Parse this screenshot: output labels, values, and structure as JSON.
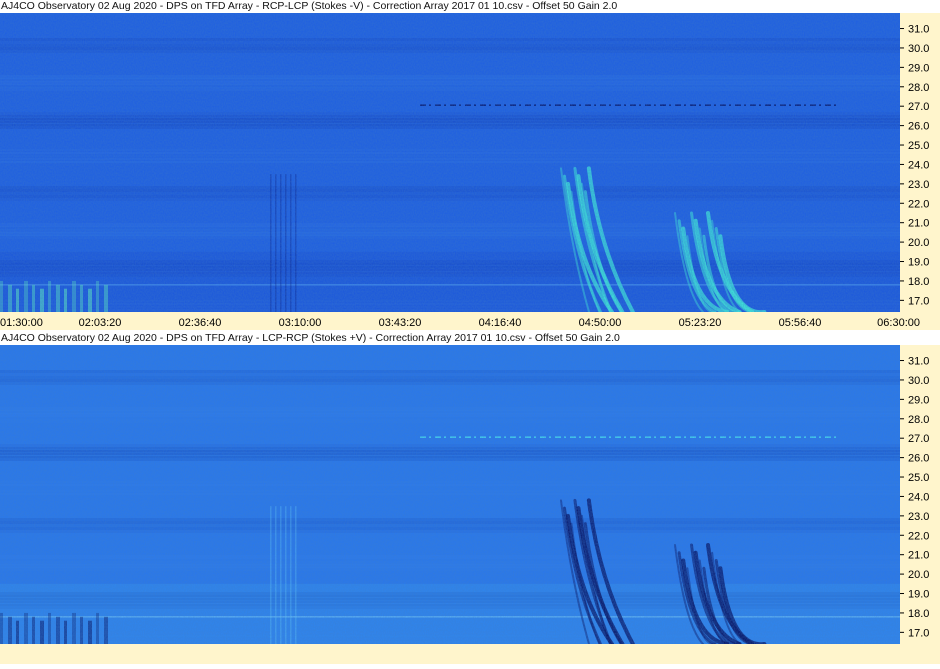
{
  "chart_data": [
    {
      "type": "heatmap",
      "title": "AJ4CO Observatory 02 Aug 2020  -  DPS on TFD Array  -  RCP-LCP (Stokes -V)  -  Correction Array 2017 01 10.csv  -  Offset 50  Gain 2.0",
      "x_ticks": [
        "01:30:00",
        "02:03:20",
        "02:36:40",
        "03:10:00",
        "03:43:20",
        "04:16:40",
        "04:50:00",
        "05:23:20",
        "05:56:40",
        "06:30:00"
      ],
      "y_ticks": [
        "31.0",
        "30.0",
        "29.0",
        "28.0",
        "27.0",
        "26.0",
        "25.0",
        "24.0",
        "23.0",
        "22.0",
        "21.0",
        "20.0",
        "19.0",
        "18.0",
        "17.0"
      ],
      "xlim": [
        "01:30:00",
        "06:30:00"
      ],
      "ylim_mhz": [
        16.4,
        31.8
      ],
      "polarity": "bright",
      "colors": {
        "base": "#2060e0",
        "bright": "#40e8d8",
        "dark": "#06156a"
      }
    },
    {
      "type": "heatmap",
      "title": "AJ4CO Observatory 02 Aug 2020  -  DPS on TFD Array  -  LCP-RCP (Stokes +V)  -  Correction Array 2017 01 10.csv  -  Offset 50  Gain 2.0",
      "x_ticks": [],
      "y_ticks": [
        "31.0",
        "30.0",
        "29.0",
        "28.0",
        "27.0",
        "26.0",
        "25.0",
        "24.0",
        "23.0",
        "22.0",
        "21.0",
        "20.0",
        "19.0",
        "18.0",
        "17.0"
      ],
      "xlim": [
        "01:30:00",
        "06:30:00"
      ],
      "ylim_mhz": [
        16.4,
        31.8
      ],
      "polarity": "dark",
      "colors": {
        "base": "#2a78ea",
        "bright": "#48e0f0",
        "dark": "#061060"
      }
    }
  ],
  "axis_background": "#fff5cc"
}
